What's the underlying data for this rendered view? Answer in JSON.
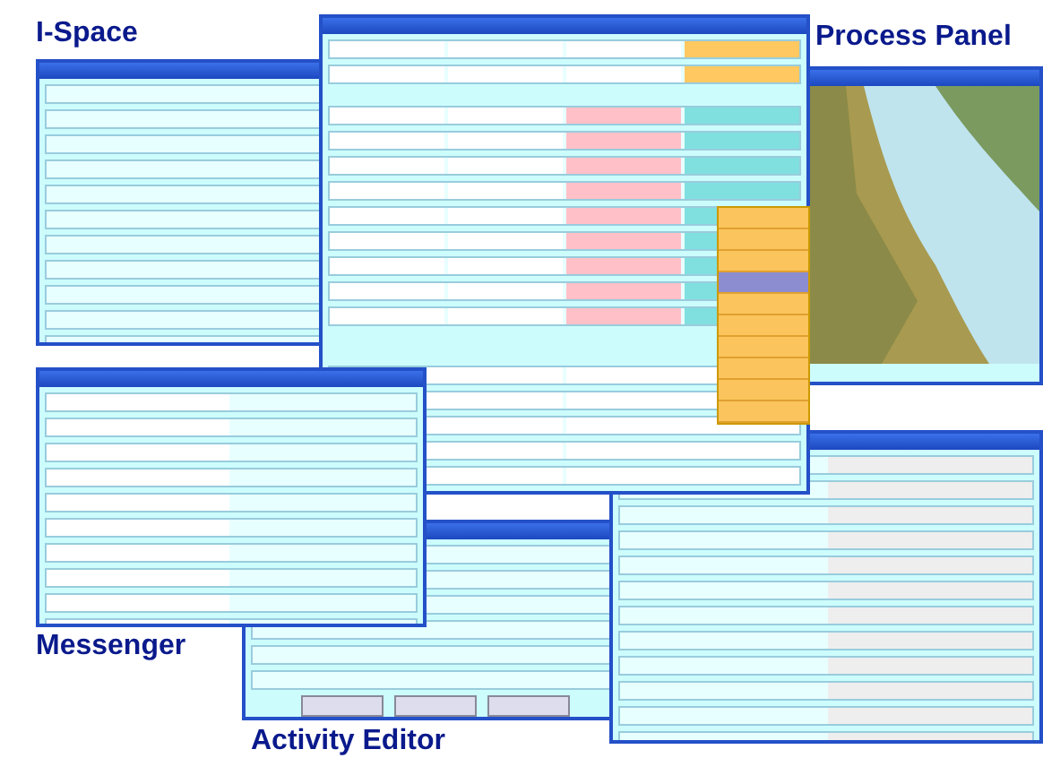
{
  "captions": [
    {
      "text": "I-Space"
    },
    {
      "text": "Process Panel"
    },
    {
      "text": "Messenger"
    },
    {
      "text": "Activity Editor"
    }
  ],
  "menu_items": [
    {
      "selected": false
    },
    {
      "selected": false
    },
    {
      "selected": false
    },
    {
      "selected": true
    },
    {
      "selected": false
    },
    {
      "selected": false
    },
    {
      "selected": false
    },
    {
      "selected": false
    },
    {
      "selected": false
    },
    {
      "selected": false
    }
  ]
}
